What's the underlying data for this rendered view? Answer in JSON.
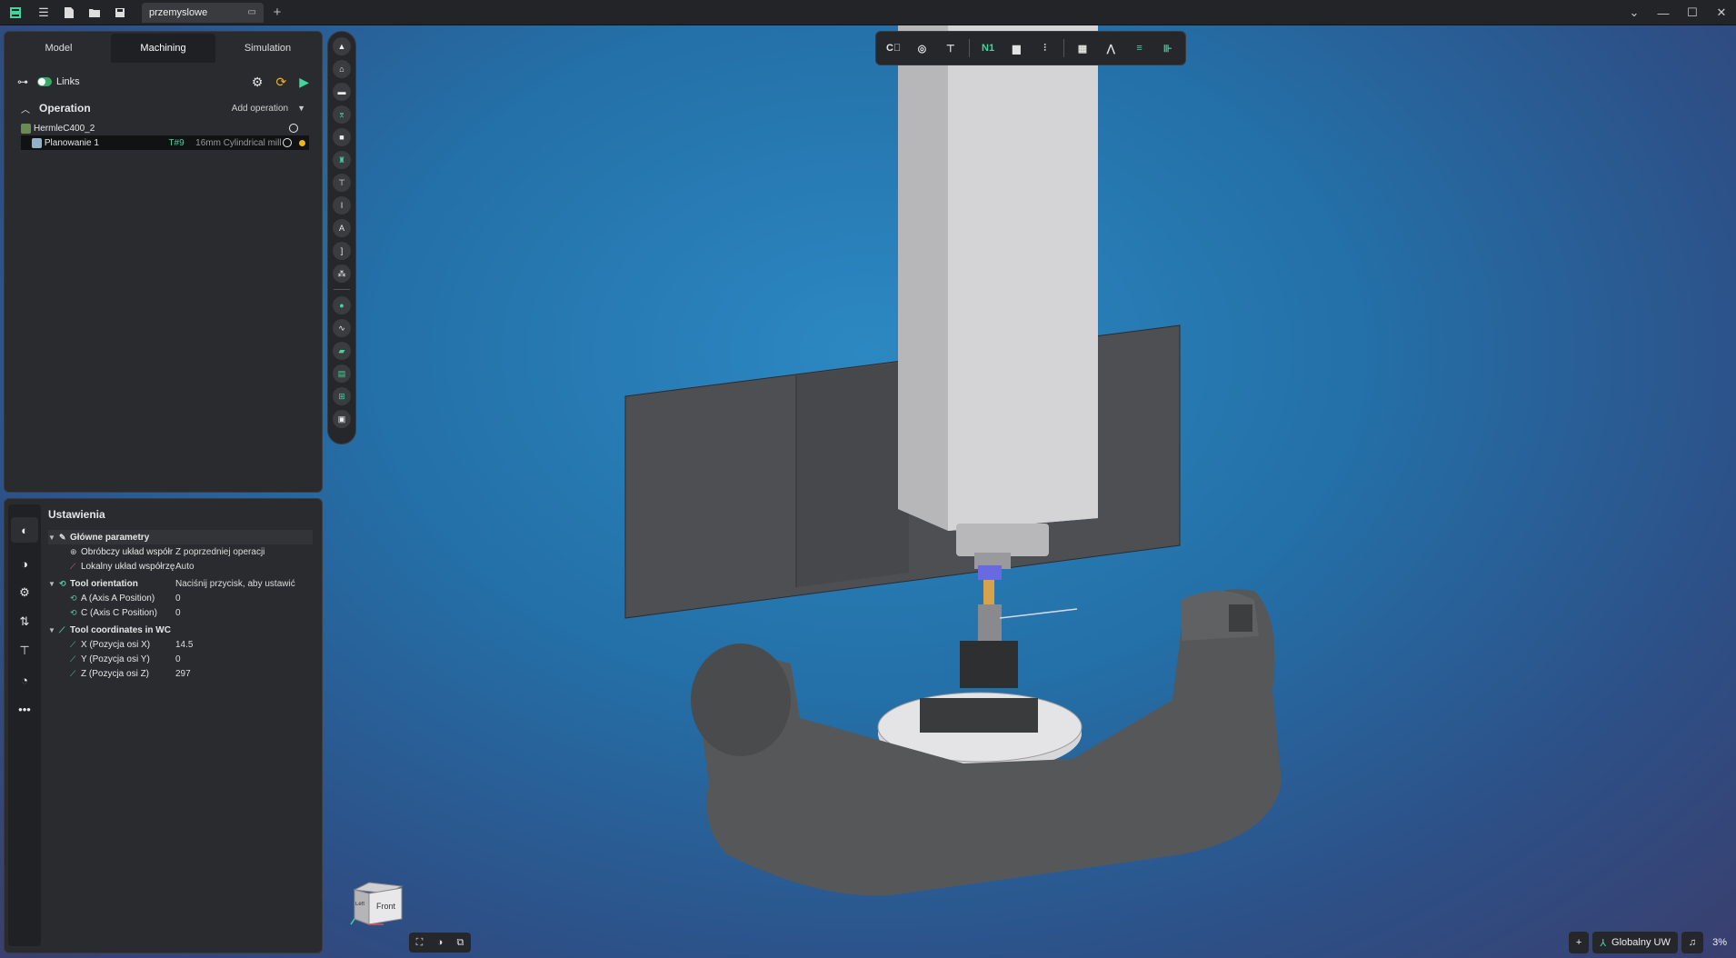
{
  "titlebar": {
    "document_tab": "przemyslowe"
  },
  "left_panel": {
    "tabs": [
      {
        "label": "Model"
      },
      {
        "label": "Machining"
      },
      {
        "label": "Simulation"
      }
    ],
    "active_tab": "Machining",
    "links_label": "Links",
    "operation_title": "Operation",
    "add_operation_label": "Add operation",
    "tree": {
      "machine": "HermleC400_2",
      "operation_name": "Planowanie 1",
      "tool_number": "T#9",
      "tool_desc": "16mm Cylindrical mill"
    }
  },
  "settings_panel": {
    "title": "Ustawienia",
    "groups": [
      {
        "label": "Główne parametry",
        "props": [
          {
            "label": "Obróbczy układ współr",
            "value": "Z poprzedniej operacji"
          },
          {
            "label": "Lokalny układ współrzę",
            "value": "Auto"
          }
        ]
      },
      {
        "label": "Tool orientation",
        "value": "Naciśnij przycisk, aby ustawić",
        "props": [
          {
            "label": "A (Axis A Position)",
            "value": "0"
          },
          {
            "label": "C (Axis C Position)",
            "value": "0"
          }
        ]
      },
      {
        "label": "Tool coordinates in WC",
        "props": [
          {
            "label": "X (Pozycja osi X)",
            "value": "14.5"
          },
          {
            "label": "Y (Pozycja osi Y)",
            "value": "0"
          },
          {
            "label": "Z (Pozycja osi Z)",
            "value": "297"
          }
        ]
      }
    ]
  },
  "top_toolbar": {
    "n1_label": "N1"
  },
  "viewport": {
    "viewcube_face": "Front",
    "viewcube_side": "Left"
  },
  "statusbar": {
    "coord_system": "Globalny UW",
    "zoom": "3%"
  },
  "colors": {
    "accent_green": "#3fd6a0",
    "status_amber": "#f2b21c",
    "tool_number": "#3fd6a0"
  }
}
